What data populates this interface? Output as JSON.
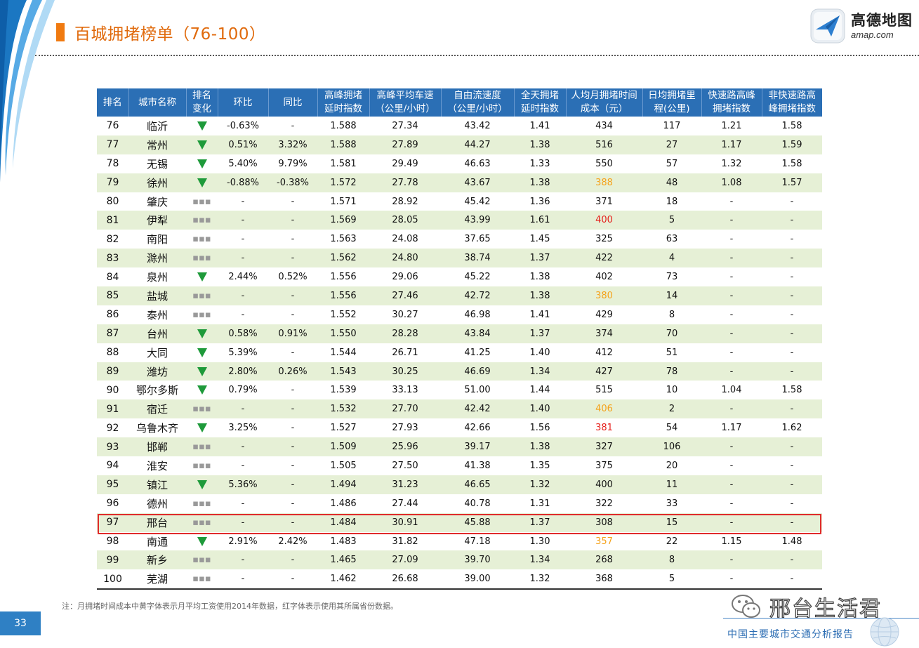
{
  "page": {
    "title": "百城拥堵榜单（76-100）",
    "page_number": "33",
    "note": "注：月拥堵时间成本中黄字体表示月平均工资使用2014年数据，红字体表示使用其所属省份数据。",
    "footer_report": "中国主要城市交通分析报告",
    "watermark": "邢台生活君"
  },
  "brand": {
    "name_cn": "高德地图",
    "name_en": "amap.com"
  },
  "colors": {
    "title": "#e06a0c",
    "header": "#2b6fb5",
    "stripe": "#e6f0d6",
    "down_arrow": "#1e9a3a",
    "yellow": "#f5a21a",
    "red": "#e5201c",
    "highlight_border": "#e02b2b"
  },
  "table": {
    "headers": [
      [
        "排名"
      ],
      [
        "城市名称"
      ],
      [
        "排名",
        "变化"
      ],
      [
        "环比"
      ],
      [
        "同比"
      ],
      [
        "高峰拥堵",
        "延时指数"
      ],
      [
        "高峰平均车速",
        "（公里/小时）"
      ],
      [
        "自由流速度",
        "（公里/小时）"
      ],
      [
        "全天拥堵",
        "延时指数"
      ],
      [
        "人均月拥堵时间",
        "成本（元）"
      ],
      [
        "日均拥堵里",
        "程(公里)"
      ],
      [
        "快速路高峰",
        "拥堵指数"
      ],
      [
        "非快速路高",
        "峰拥堵指数"
      ]
    ],
    "rows": [
      {
        "rank": "76",
        "city": "临沂",
        "change": "down",
        "mom": "-0.63%",
        "yoy": "-",
        "peak_index": "1.588",
        "peak_speed": "27.34",
        "free_speed": "43.42",
        "day_index": "1.41",
        "cost": "434",
        "cost_color": "",
        "km": "117",
        "express": "1.21",
        "nonexpress": "1.58"
      },
      {
        "rank": "77",
        "city": "常州",
        "change": "down",
        "mom": "0.51%",
        "yoy": "3.32%",
        "peak_index": "1.588",
        "peak_speed": "27.89",
        "free_speed": "44.27",
        "day_index": "1.38",
        "cost": "516",
        "cost_color": "",
        "km": "27",
        "express": "1.17",
        "nonexpress": "1.59"
      },
      {
        "rank": "78",
        "city": "无锡",
        "change": "down",
        "mom": "5.40%",
        "yoy": "9.79%",
        "peak_index": "1.581",
        "peak_speed": "29.49",
        "free_speed": "46.63",
        "day_index": "1.33",
        "cost": "550",
        "cost_color": "",
        "km": "57",
        "express": "1.32",
        "nonexpress": "1.58"
      },
      {
        "rank": "79",
        "city": "徐州",
        "change": "down",
        "mom": "-0.88%",
        "yoy": "-0.38%",
        "peak_index": "1.572",
        "peak_speed": "27.78",
        "free_speed": "43.67",
        "day_index": "1.38",
        "cost": "388",
        "cost_color": "yellow",
        "km": "48",
        "express": "1.08",
        "nonexpress": "1.57"
      },
      {
        "rank": "80",
        "city": "肇庆",
        "change": "same",
        "mom": "-",
        "yoy": "-",
        "peak_index": "1.571",
        "peak_speed": "28.92",
        "free_speed": "45.42",
        "day_index": "1.36",
        "cost": "371",
        "cost_color": "",
        "km": "18",
        "express": "-",
        "nonexpress": "-"
      },
      {
        "rank": "81",
        "city": "伊犁",
        "change": "same",
        "mom": "-",
        "yoy": "-",
        "peak_index": "1.569",
        "peak_speed": "28.05",
        "free_speed": "43.99",
        "day_index": "1.61",
        "cost": "400",
        "cost_color": "red",
        "km": "5",
        "express": "-",
        "nonexpress": "-"
      },
      {
        "rank": "82",
        "city": "南阳",
        "change": "same",
        "mom": "-",
        "yoy": "-",
        "peak_index": "1.563",
        "peak_speed": "24.08",
        "free_speed": "37.65",
        "day_index": "1.45",
        "cost": "325",
        "cost_color": "",
        "km": "63",
        "express": "-",
        "nonexpress": "-"
      },
      {
        "rank": "83",
        "city": "滁州",
        "change": "same",
        "mom": "-",
        "yoy": "-",
        "peak_index": "1.562",
        "peak_speed": "24.80",
        "free_speed": "38.74",
        "day_index": "1.37",
        "cost": "422",
        "cost_color": "",
        "km": "4",
        "express": "-",
        "nonexpress": "-"
      },
      {
        "rank": "84",
        "city": "泉州",
        "change": "down",
        "mom": "2.44%",
        "yoy": "0.52%",
        "peak_index": "1.556",
        "peak_speed": "29.06",
        "free_speed": "45.22",
        "day_index": "1.38",
        "cost": "402",
        "cost_color": "",
        "km": "73",
        "express": "-",
        "nonexpress": "-"
      },
      {
        "rank": "85",
        "city": "盐城",
        "change": "same",
        "mom": "-",
        "yoy": "-",
        "peak_index": "1.556",
        "peak_speed": "27.46",
        "free_speed": "42.72",
        "day_index": "1.38",
        "cost": "380",
        "cost_color": "yellow",
        "km": "14",
        "express": "-",
        "nonexpress": "-"
      },
      {
        "rank": "86",
        "city": "泰州",
        "change": "same",
        "mom": "-",
        "yoy": "-",
        "peak_index": "1.552",
        "peak_speed": "30.27",
        "free_speed": "46.98",
        "day_index": "1.41",
        "cost": "429",
        "cost_color": "",
        "km": "8",
        "express": "-",
        "nonexpress": "-"
      },
      {
        "rank": "87",
        "city": "台州",
        "change": "down",
        "mom": "0.58%",
        "yoy": "0.91%",
        "peak_index": "1.550",
        "peak_speed": "28.28",
        "free_speed": "43.84",
        "day_index": "1.37",
        "cost": "374",
        "cost_color": "",
        "km": "70",
        "express": "-",
        "nonexpress": "-"
      },
      {
        "rank": "88",
        "city": "大同",
        "change": "down",
        "mom": "5.39%",
        "yoy": "-",
        "peak_index": "1.544",
        "peak_speed": "26.71",
        "free_speed": "41.25",
        "day_index": "1.40",
        "cost": "412",
        "cost_color": "",
        "km": "51",
        "express": "-",
        "nonexpress": "-"
      },
      {
        "rank": "89",
        "city": "潍坊",
        "change": "down",
        "mom": "2.80%",
        "yoy": "0.26%",
        "peak_index": "1.543",
        "peak_speed": "30.25",
        "free_speed": "46.69",
        "day_index": "1.34",
        "cost": "427",
        "cost_color": "",
        "km": "78",
        "express": "-",
        "nonexpress": "-"
      },
      {
        "rank": "90",
        "city": "鄂尔多斯",
        "change": "down",
        "mom": "0.79%",
        "yoy": "-",
        "peak_index": "1.539",
        "peak_speed": "33.13",
        "free_speed": "51.00",
        "day_index": "1.44",
        "cost": "515",
        "cost_color": "",
        "km": "10",
        "express": "1.04",
        "nonexpress": "1.58"
      },
      {
        "rank": "91",
        "city": "宿迁",
        "change": "same",
        "mom": "-",
        "yoy": "-",
        "peak_index": "1.532",
        "peak_speed": "27.70",
        "free_speed": "42.42",
        "day_index": "1.40",
        "cost": "406",
        "cost_color": "yellow",
        "km": "2",
        "express": "-",
        "nonexpress": "-"
      },
      {
        "rank": "92",
        "city": "乌鲁木齐",
        "change": "down",
        "mom": "3.25%",
        "yoy": "-",
        "peak_index": "1.527",
        "peak_speed": "27.93",
        "free_speed": "42.66",
        "day_index": "1.56",
        "cost": "381",
        "cost_color": "red",
        "km": "54",
        "express": "1.17",
        "nonexpress": "1.62"
      },
      {
        "rank": "93",
        "city": "邯郸",
        "change": "same",
        "mom": "-",
        "yoy": "-",
        "peak_index": "1.509",
        "peak_speed": "25.96",
        "free_speed": "39.17",
        "day_index": "1.38",
        "cost": "327",
        "cost_color": "",
        "km": "106",
        "express": "-",
        "nonexpress": "-"
      },
      {
        "rank": "94",
        "city": "淮安",
        "change": "same",
        "mom": "-",
        "yoy": "-",
        "peak_index": "1.505",
        "peak_speed": "27.50",
        "free_speed": "41.38",
        "day_index": "1.35",
        "cost": "375",
        "cost_color": "",
        "km": "20",
        "express": "-",
        "nonexpress": "-"
      },
      {
        "rank": "95",
        "city": "镇江",
        "change": "down",
        "mom": "5.36%",
        "yoy": "-",
        "peak_index": "1.494",
        "peak_speed": "31.23",
        "free_speed": "46.65",
        "day_index": "1.32",
        "cost": "400",
        "cost_color": "",
        "km": "11",
        "express": "-",
        "nonexpress": "-"
      },
      {
        "rank": "96",
        "city": "德州",
        "change": "same",
        "mom": "-",
        "yoy": "-",
        "peak_index": "1.486",
        "peak_speed": "27.44",
        "free_speed": "40.78",
        "day_index": "1.31",
        "cost": "322",
        "cost_color": "",
        "km": "33",
        "express": "-",
        "nonexpress": "-"
      },
      {
        "rank": "97",
        "city": "邢台",
        "change": "same",
        "mom": "-",
        "yoy": "-",
        "peak_index": "1.484",
        "peak_speed": "30.91",
        "free_speed": "45.88",
        "day_index": "1.37",
        "cost": "308",
        "cost_color": "",
        "km": "15",
        "express": "-",
        "nonexpress": "-",
        "highlight": true
      },
      {
        "rank": "98",
        "city": "南通",
        "change": "down",
        "mom": "2.91%",
        "yoy": "2.42%",
        "peak_index": "1.483",
        "peak_speed": "31.82",
        "free_speed": "47.18",
        "day_index": "1.30",
        "cost": "357",
        "cost_color": "yellow",
        "km": "22",
        "express": "1.15",
        "nonexpress": "1.48"
      },
      {
        "rank": "99",
        "city": "新乡",
        "change": "same",
        "mom": "-",
        "yoy": "-",
        "peak_index": "1.465",
        "peak_speed": "27.09",
        "free_speed": "39.70",
        "day_index": "1.34",
        "cost": "268",
        "cost_color": "",
        "km": "8",
        "express": "-",
        "nonexpress": "-"
      },
      {
        "rank": "100",
        "city": "芜湖",
        "change": "same",
        "mom": "-",
        "yoy": "-",
        "peak_index": "1.462",
        "peak_speed": "26.68",
        "free_speed": "39.00",
        "day_index": "1.32",
        "cost": "368",
        "cost_color": "",
        "km": "5",
        "express": "-",
        "nonexpress": "-"
      }
    ]
  }
}
